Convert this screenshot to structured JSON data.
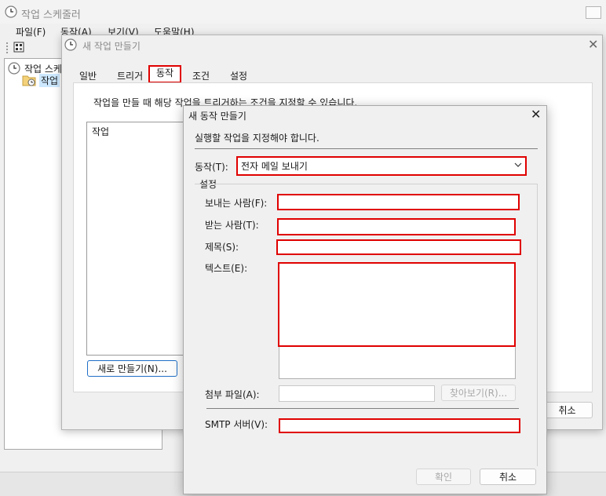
{
  "app": {
    "title": "작업 스케줄러",
    "menu": [
      "파일(F)",
      "동작(A)",
      "보기(V)",
      "도움말(H)"
    ],
    "tree": {
      "root": "작업 스케",
      "child": "작업"
    }
  },
  "create_task": {
    "title": "새 작업 만들기",
    "tabs": [
      "일반",
      "트리거",
      "동작",
      "조건",
      "설정"
    ],
    "active_tab": "동작",
    "description": "작업을 만들 때 해당 작업을 트리거하는 조건을 지정할 수 있습니다.",
    "list_header": "작업",
    "new_button": "새로 만들기(N)...",
    "cancel_button": "취소"
  },
  "new_action": {
    "title": "새 동작 만들기",
    "instruction": "실행할 작업을 지정해야 합니다.",
    "action_label": "동작(T):",
    "action_value": "전자 메일 보내기",
    "settings_group": "설정",
    "from_label": "보내는 사람(F):",
    "from_value": "",
    "to_label": "받는 사람(T):",
    "to_value": "",
    "subject_label": "제목(S):",
    "subject_value": "",
    "text_label": "텍스트(E):",
    "text_value": "",
    "attachment_label": "첨부 파일(A):",
    "attachment_value": "",
    "browse_button": "찾아보기(R)...",
    "smtp_label": "SMTP 서버(V):",
    "smtp_value": "",
    "ok_button": "확인",
    "cancel_button": "취소"
  },
  "colors": {
    "highlight": "#e00000",
    "window_bg": "#f0f0f0",
    "selected": "#cde8ff"
  }
}
